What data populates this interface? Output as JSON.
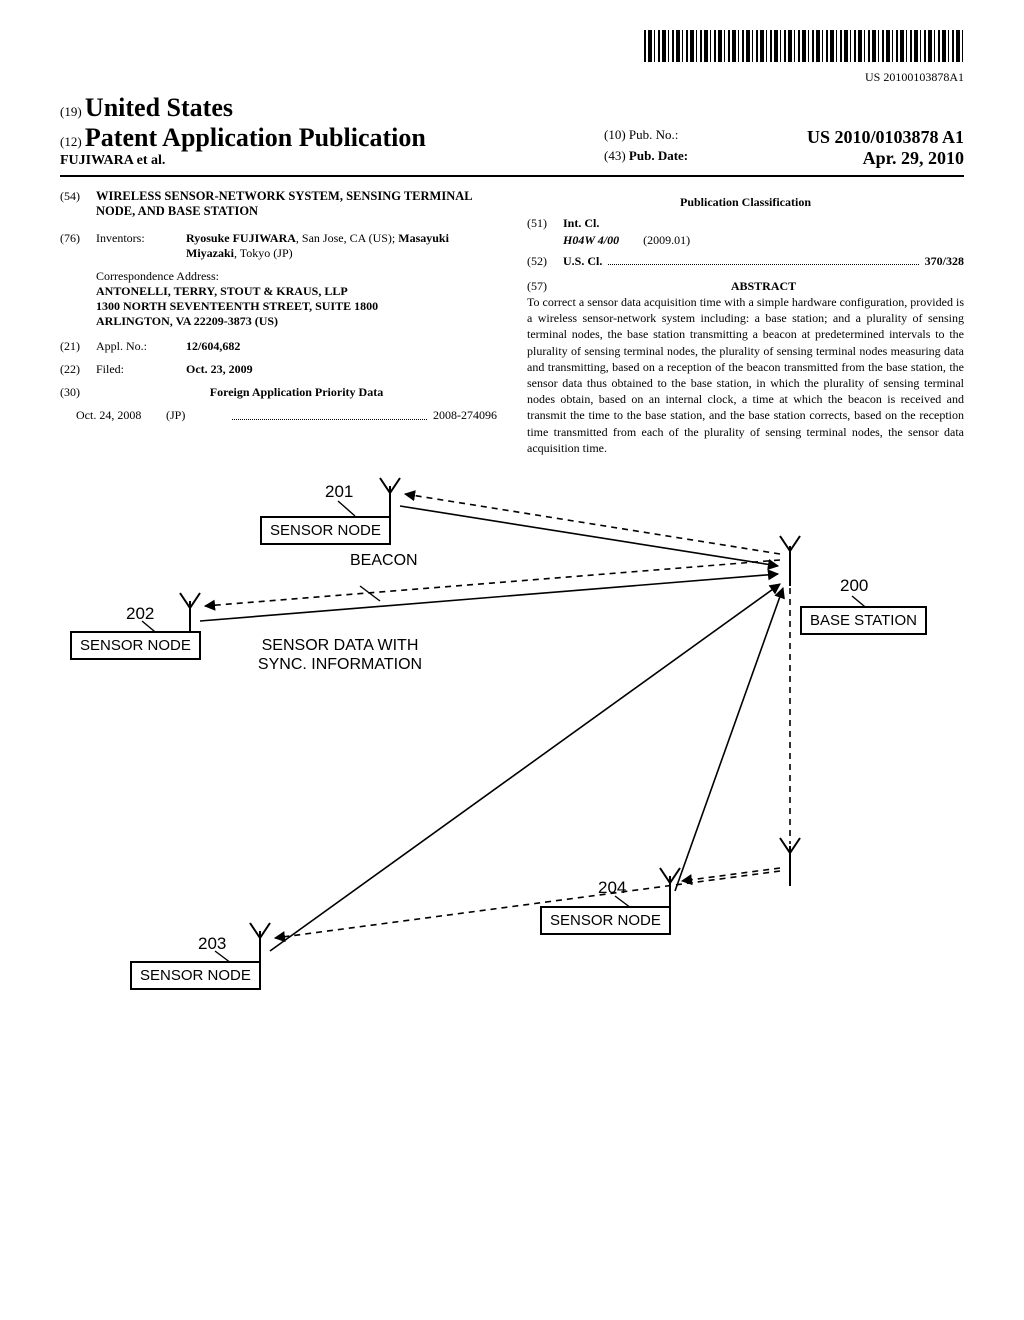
{
  "barcode_text": "US 20100103878A1",
  "header": {
    "code_19": "(19)",
    "country": "United States",
    "code_12": "(12)",
    "doc_type": "Patent Application Publication",
    "authors_line": "FUJIWARA et al.",
    "code_10": "(10)",
    "pub_no_label": "Pub. No.:",
    "pub_no": "US 2010/0103878 A1",
    "code_43": "(43)",
    "pub_date_label": "Pub. Date:",
    "pub_date": "Apr. 29, 2010"
  },
  "left": {
    "code_54": "(54)",
    "title": "WIRELESS SENSOR-NETWORK SYSTEM, SENSING TERMINAL NODE, AND BASE STATION",
    "code_76": "(76)",
    "inventors_label": "Inventors:",
    "inventors": "Ryosuke FUJIWARA, San Jose, CA (US); Masayuki Miyazaki, Tokyo (JP)",
    "inv_name1": "Ryosuke FUJIWARA",
    "inv_loc1": ", San Jose, CA (US); ",
    "inv_name2": "Masayuki Miyazaki",
    "inv_loc2": ", Tokyo (JP)",
    "corr_label": "Correspondence Address:",
    "corr_1": "ANTONELLI, TERRY, STOUT & KRAUS, LLP",
    "corr_2": "1300 NORTH SEVENTEENTH STREET, SUITE 1800",
    "corr_3": "ARLINGTON, VA 22209-3873 (US)",
    "code_21": "(21)",
    "appl_label": "Appl. No.:",
    "appl_no": "12/604,682",
    "code_22": "(22)",
    "filed_label": "Filed:",
    "filed": "Oct. 23, 2009",
    "code_30": "(30)",
    "priority_head": "Foreign Application Priority Data",
    "priority_date": "Oct. 24, 2008",
    "priority_country": "(JP)",
    "priority_no": "2008-274096"
  },
  "right": {
    "pub_class_head": "Publication Classification",
    "code_51": "(51)",
    "int_cl_label": "Int. Cl.",
    "int_cl_sym": "H04W 4/00",
    "int_cl_year": "(2009.01)",
    "code_52": "(52)",
    "us_cl_label": "U.S. Cl.",
    "us_cl_val": "370/328",
    "code_57": "(57)",
    "abstract_label": "ABSTRACT",
    "abstract_text": "To correct a sensor data acquisition time with a simple hardware configuration, provided is a wireless sensor-network system including: a base station; and a plurality of sensing terminal nodes, the base station transmitting a beacon at predetermined intervals to the plurality of sensing terminal nodes, the plurality of sensing terminal nodes measuring data and transmitting, based on a reception of the beacon transmitted from the base station, the sensor data thus obtained to the base station, in which the plurality of sensing terminal nodes obtain, based on an internal clock, a time at which the beacon is received and transmit the time to the base station, and the base station corrects, based on the reception time transmitted from each of the plurality of sensing terminal nodes, the sensor data acquisition time."
  },
  "figure": {
    "node1": {
      "num": "201",
      "label": "SENSOR NODE"
    },
    "node2": {
      "num": "202",
      "label": "SENSOR NODE"
    },
    "node3": {
      "num": "203",
      "label": "SENSOR NODE"
    },
    "node4": {
      "num": "204",
      "label": "SENSOR NODE"
    },
    "base": {
      "num": "200",
      "label": "BASE STATION"
    },
    "beacon_label": "BEACON",
    "data_label_1": "SENSOR DATA WITH",
    "data_label_2": "SYNC. INFORMATION"
  }
}
